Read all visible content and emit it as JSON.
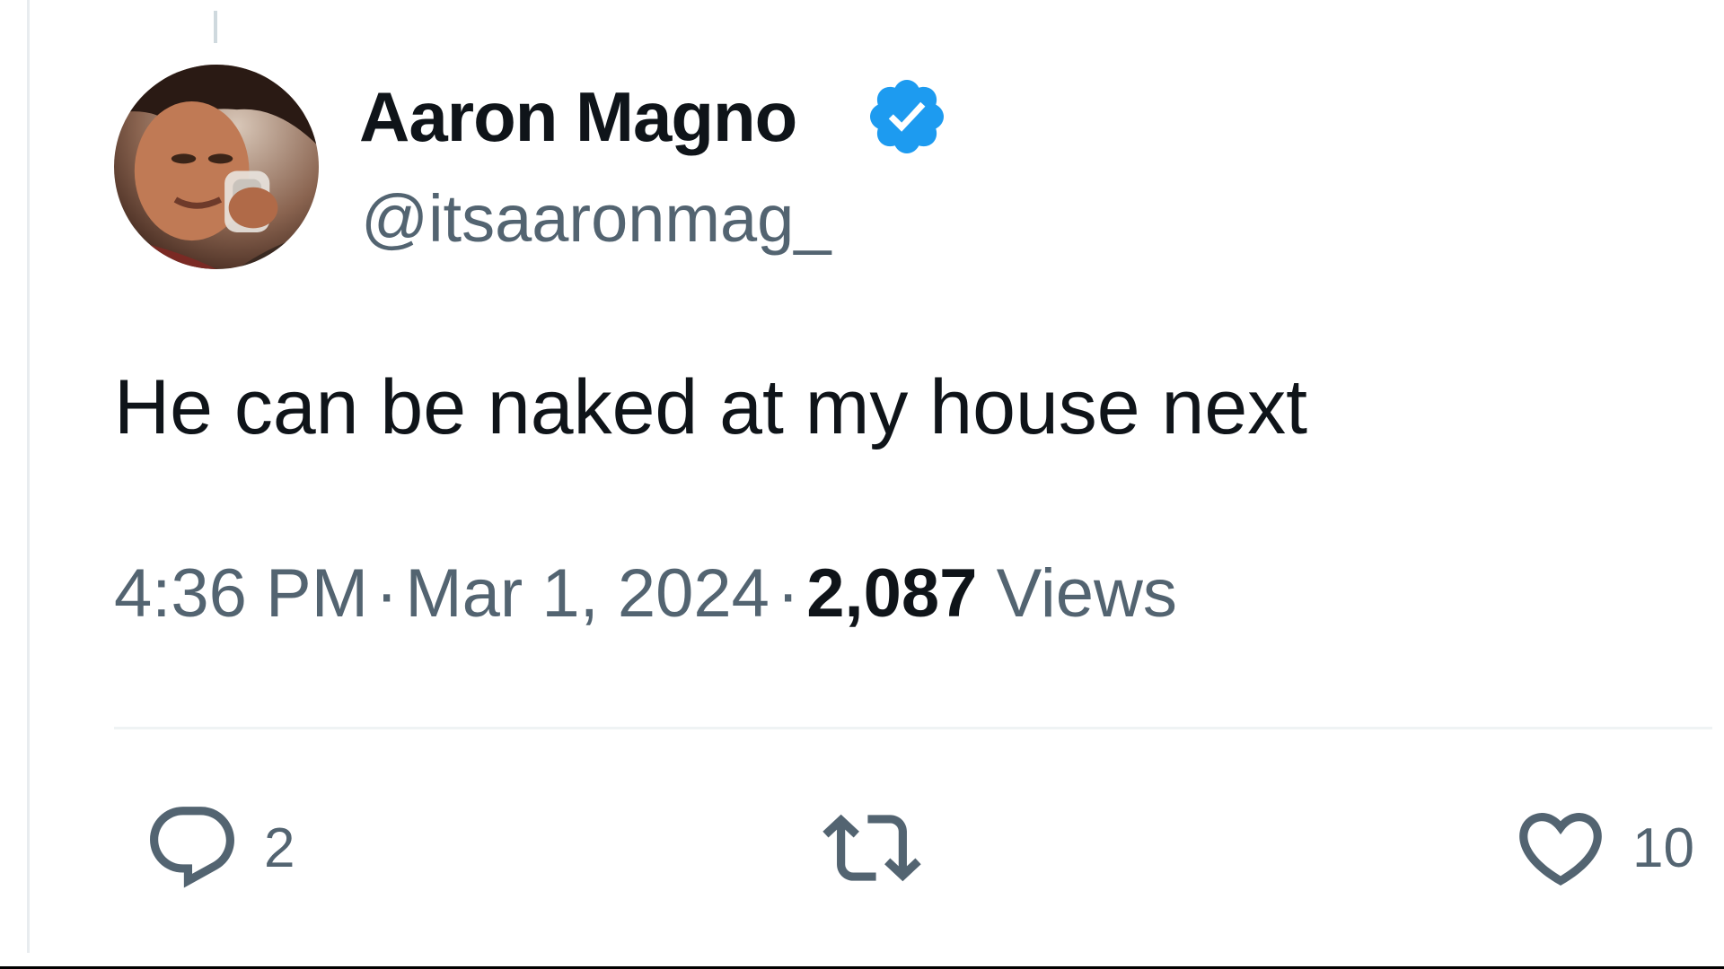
{
  "author": {
    "display_name": "Aaron Magno",
    "handle": "@itsaaronmag_",
    "verified": true,
    "verified_color": "#1d9bf0",
    "avatar_icon": "user-avatar-photo"
  },
  "tweet": {
    "text": "He can be naked at my house next"
  },
  "meta": {
    "time": "4:36 PM",
    "separator": "·",
    "date": "Mar 1, 2024",
    "views_count": "2,087",
    "views_label": "Views"
  },
  "actions": {
    "reply": {
      "icon": "reply-icon",
      "count": "2"
    },
    "repost": {
      "icon": "repost-icon",
      "count": ""
    },
    "like": {
      "icon": "heart-icon",
      "count": "10"
    }
  },
  "colors": {
    "text_primary": "#0f1419",
    "text_secondary": "#536471",
    "accent": "#1d9bf0"
  }
}
